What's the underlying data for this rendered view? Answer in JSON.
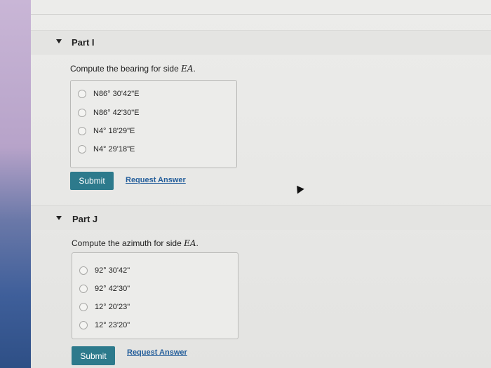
{
  "part_i": {
    "title": "Part I",
    "question_prefix": "Compute the bearing for side ",
    "question_var": "EA",
    "question_suffix": ".",
    "choices": [
      "N86° 30'42\"E",
      "N86° 42'30\"E",
      "N4° 18'29\"E",
      "N4° 29'18\"E"
    ],
    "submit_label": "Submit",
    "request_label": "Request Answer"
  },
  "part_j": {
    "title": "Part J",
    "question_prefix": "Compute the azimuth for side ",
    "question_var": "EA",
    "question_suffix": ".",
    "choices": [
      "92° 30'42\"",
      "92° 42'30\"",
      "12° 20'23\"",
      "12° 23'20\""
    ],
    "submit_label": "Submit",
    "request_label": "Request Answer"
  },
  "colors": {
    "submit_bg": "#2d7a8c",
    "link": "#245e9b"
  }
}
